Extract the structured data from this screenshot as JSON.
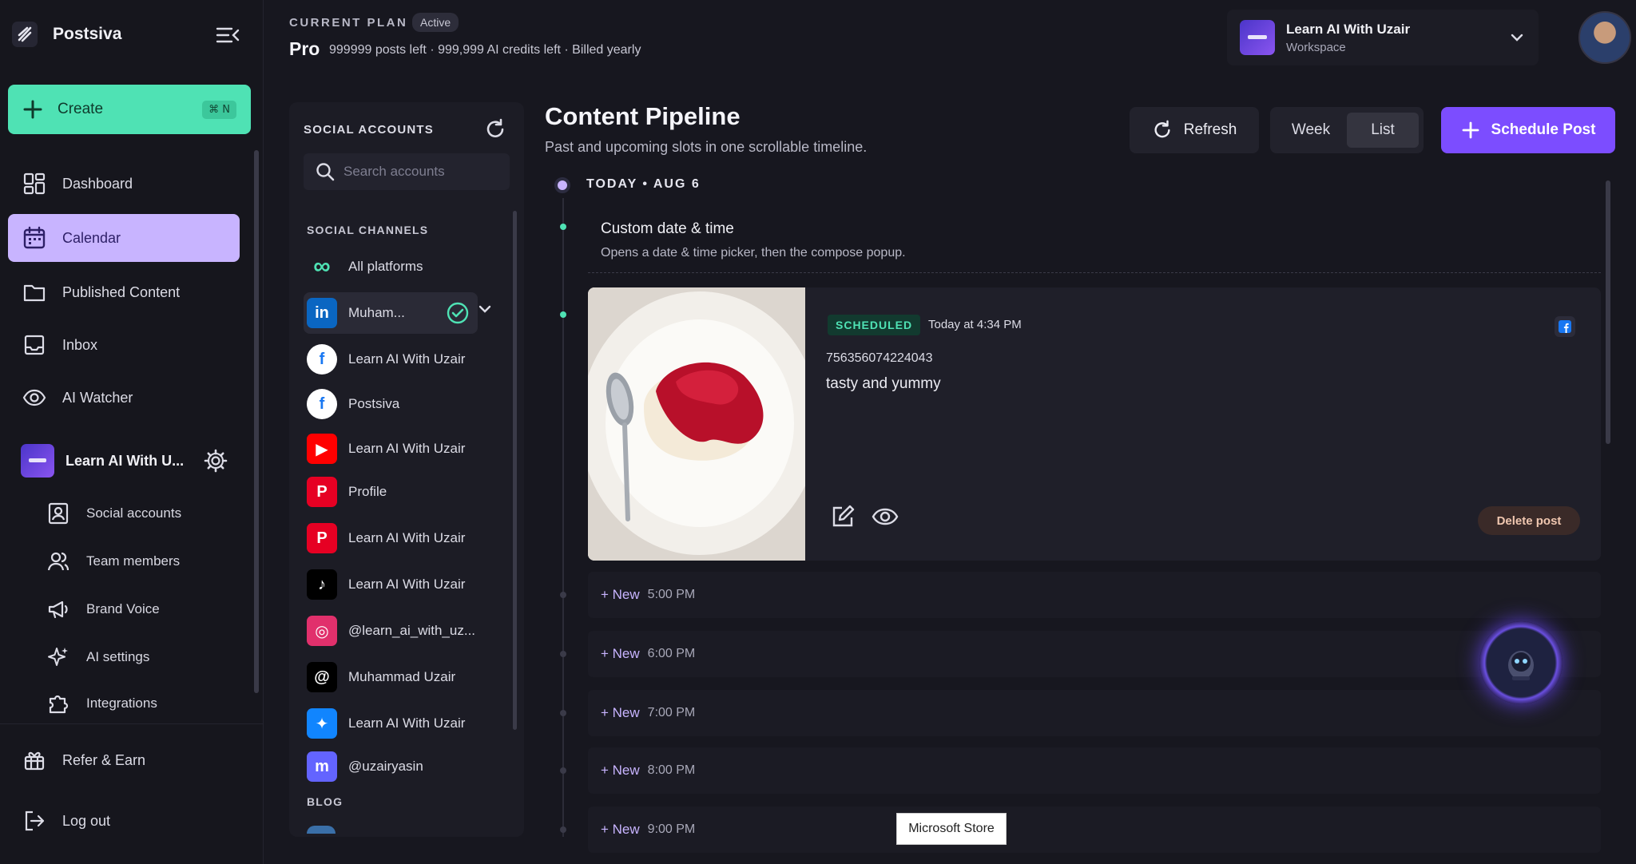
{
  "brand": {
    "name": "Postsiva"
  },
  "sidebar": {
    "create_label": "Create",
    "create_shortcut": "⌘ N",
    "nav": [
      {
        "label": "Dashboard",
        "icon": "dashboard-icon"
      },
      {
        "label": "Calendar",
        "icon": "calendar-icon"
      },
      {
        "label": "Published Content",
        "icon": "folder-icon"
      },
      {
        "label": "Inbox",
        "icon": "inbox-icon"
      },
      {
        "label": "AI Watcher",
        "icon": "eye-icon"
      }
    ],
    "workspace": {
      "name": "Learn AI With U..."
    },
    "sub": [
      {
        "label": "Social accounts"
      },
      {
        "label": "Team members"
      },
      {
        "label": "Brand Voice"
      },
      {
        "label": "AI settings"
      },
      {
        "label": "Integrations"
      }
    ],
    "refer_label": "Refer & Earn",
    "logout_label": "Log out"
  },
  "header": {
    "plan_label": "CURRENT PLAN",
    "plan_status": "Active",
    "plan_name": "Pro",
    "plan_details": "999999 posts left · 999,999 AI credits left · Billed yearly",
    "workspace_title": "Learn AI With Uzair",
    "workspace_sub": "Workspace"
  },
  "social": {
    "title": "SOCIAL ACCOUNTS",
    "search_placeholder": "Search accounts",
    "channels_title": "SOCIAL CHANNELS",
    "channels": [
      {
        "label": "All platforms",
        "platform": "all",
        "color": "#4fe2b4"
      },
      {
        "label": "Muham...",
        "platform": "linkedin",
        "color": "#0a66c2"
      },
      {
        "label": "Learn AI With Uzair",
        "platform": "facebook",
        "color": "#1877f2"
      },
      {
        "label": "Postsiva",
        "platform": "facebook",
        "color": "#1877f2"
      },
      {
        "label": "Learn AI With Uzair",
        "platform": "youtube",
        "color": "#ff0000"
      },
      {
        "label": "Profile",
        "platform": "pinterest",
        "color": "#e60023"
      },
      {
        "label": "Learn AI With Uzair",
        "platform": "pinterest",
        "color": "#e60023"
      },
      {
        "label": "Learn AI With Uzair",
        "platform": "tiktok",
        "color": "#000000"
      },
      {
        "label": "@learn_ai_with_uz...",
        "platform": "instagram",
        "color": "#e1306c"
      },
      {
        "label": "Muhammad Uzair",
        "platform": "threads",
        "color": "#000000"
      },
      {
        "label": "Learn AI With Uzair",
        "platform": "bluesky",
        "color": "#1185fe"
      },
      {
        "label": "@uzairyasin",
        "platform": "mastodon",
        "color": "#6364ff"
      }
    ],
    "blog_title": "BLOG"
  },
  "main": {
    "title": "Content Pipeline",
    "subtitle": "Past and upcoming slots in one scrollable timeline.",
    "refresh_label": "Refresh",
    "view_week": "Week",
    "view_list": "List",
    "schedule_label": "Schedule Post",
    "today_label": "TODAY • AUG 6",
    "custom_title": "Custom date & time",
    "custom_sub": "Opens a date & time picker, then the compose popup.",
    "post": {
      "status": "SCHEDULED",
      "time": "Today at 4:34 PM",
      "id": "756356074224043",
      "text": "tasty and yummy",
      "delete_label": "Delete post"
    },
    "slots": [
      {
        "new": "+ New",
        "time": "5:00 PM"
      },
      {
        "new": "+ New",
        "time": "6:00 PM"
      },
      {
        "new": "+ New",
        "time": "7:00 PM"
      },
      {
        "new": "+ New",
        "time": "8:00 PM"
      },
      {
        "new": "+ New",
        "time": "9:00 PM"
      }
    ]
  },
  "tooltip": "Microsoft Store",
  "colors": {
    "accent": "#7c4dff",
    "create": "#4fe2b4",
    "active_nav": "#c8b4ff"
  }
}
